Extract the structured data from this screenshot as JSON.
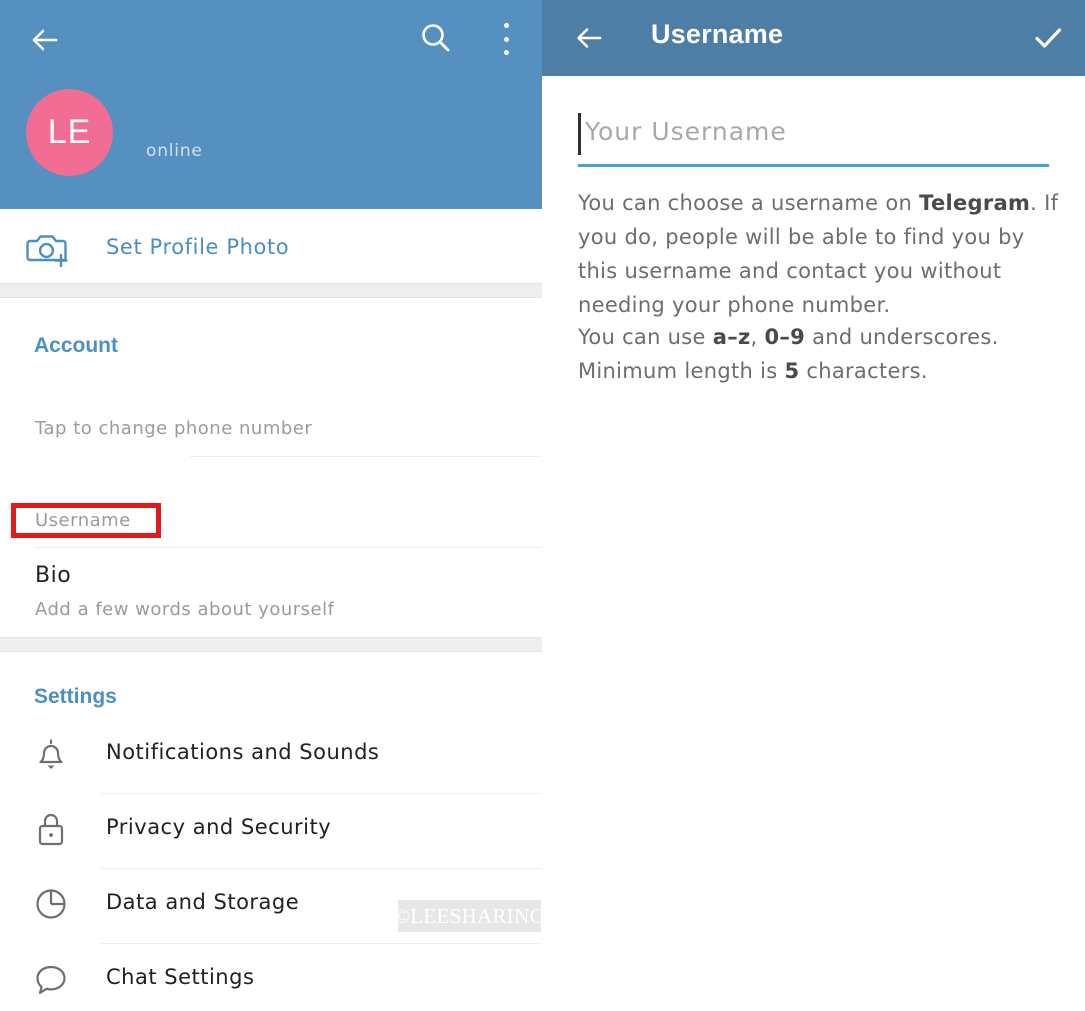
{
  "left_panel": {
    "header": {
      "back_icon": "arrow-left-icon",
      "search_icon": "search-icon",
      "overflow_icon": "more-vertical-icon",
      "avatar_initials": "LE",
      "status": "online",
      "background_color": "#5590c0",
      "avatar_color": "#f26d94"
    },
    "set_profile_photo": {
      "icon": "camera-add-icon",
      "label": "Set Profile Photo",
      "color": "#4a8fc2"
    },
    "account_section": {
      "header": "Account",
      "header_color": "#4a90c4",
      "phone_row_label": "Tap to change phone number",
      "username_row_label": "Username",
      "username_highlight_color": "#e01b1b",
      "bio_title": "Bio",
      "bio_subtitle": "Add a few words about yourself"
    },
    "settings_section": {
      "header": "Settings",
      "items": [
        {
          "icon": "bell-icon",
          "label": "Notifications and Sounds"
        },
        {
          "icon": "lock-icon",
          "label": "Privacy and Security"
        },
        {
          "icon": "pie-chart-icon",
          "label": "Data and Storage"
        },
        {
          "icon": "chat-bubble-icon",
          "label": "Chat Settings"
        }
      ]
    },
    "watermark": "©LEESHARING"
  },
  "right_panel": {
    "header": {
      "back_icon": "arrow-left-icon",
      "title": "Username",
      "confirm_icon": "check-icon",
      "background_color": "#4e7da6"
    },
    "input": {
      "value": "",
      "placeholder": "Your Username",
      "underline_color": "#46a2d2"
    },
    "description": {
      "paragraph_1_a": "You can choose a username on ",
      "paragraph_1_bold": "Telegram",
      "paragraph_1_b": ". If you do, people will be able to find you by this username and contact you without needing your phone number.",
      "paragraph_2_a": "You can use ",
      "paragraph_2_bold_1": "a–z",
      "paragraph_2_b": ", ",
      "paragraph_2_bold_2": "0–9",
      "paragraph_2_c": " and underscores. Minimum length is ",
      "paragraph_2_bold_3": "5",
      "paragraph_2_d": " characters."
    }
  }
}
